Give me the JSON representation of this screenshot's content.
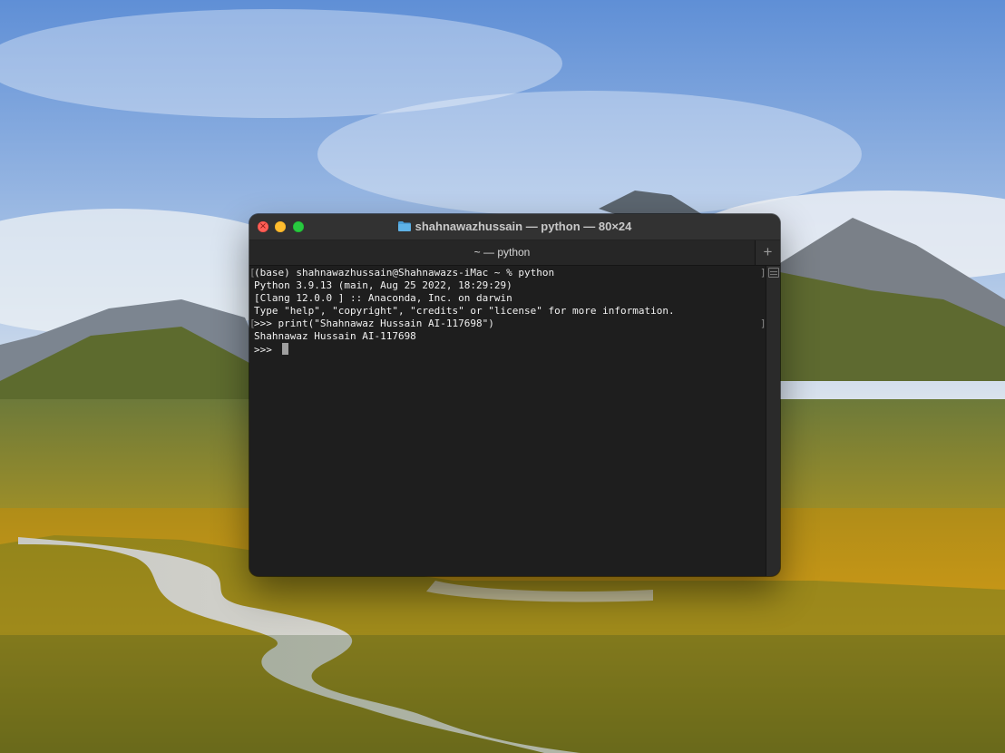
{
  "window": {
    "title": "shahnawazhussain — python — 80×24",
    "folder_icon": "folder-icon",
    "close_glyph": "×"
  },
  "tabs": [
    {
      "label": "~ — python",
      "active": true
    }
  ],
  "tab_add_label": "+",
  "terminal": {
    "lines": [
      "(base) shahnawazhussain@Shahnawazs-iMac ~ % python",
      "Python 3.9.13 (main, Aug 25 2022, 18:29:29)",
      "[Clang 12.0.0 ] :: Anaconda, Inc. on darwin",
      "Type \"help\", \"copyright\", \"credits\" or \"license\" for more information.",
      ">>> print(\"Shahnawaz Hussain AI-117698\")",
      "Shahnawaz Hussain AI-117698",
      ">>> "
    ],
    "marked_lines": [
      0,
      4
    ],
    "cursor_line": 6,
    "bracket_left": "[",
    "bracket_right": "]"
  },
  "colors": {
    "close": "#ff5f57",
    "minimize": "#febc2e",
    "zoom": "#28c840",
    "terminal_bg": "#1e1e1e",
    "terminal_text": "#f0f0f0",
    "folder": "#4a9fd8"
  },
  "icons": {
    "close": "close-icon",
    "minimize": "minimize-icon",
    "zoom": "zoom-icon",
    "tab_add": "plus-icon",
    "scroll": "scroll-marks-icon"
  }
}
